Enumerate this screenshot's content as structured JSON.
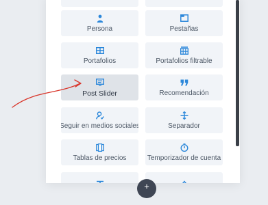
{
  "modules": [
    {
      "label": "",
      "icon": "blank-icon"
    },
    {
      "label": "",
      "icon": "blank-icon"
    },
    {
      "label": "Persona",
      "icon": "person-icon"
    },
    {
      "label": "Pestañas",
      "icon": "tabs-icon"
    },
    {
      "label": "Portafolios",
      "icon": "portfolio-grid-icon"
    },
    {
      "label": "Portafolios filtrable",
      "icon": "filterable-portfolio-icon"
    },
    {
      "label": "Post Slider",
      "icon": "post-slider-icon"
    },
    {
      "label": "Recomendación",
      "icon": "quote-icon"
    },
    {
      "label": "Seguir en medios sociales",
      "icon": "social-follow-icon"
    },
    {
      "label": "Separador",
      "icon": "divider-icon"
    },
    {
      "label": "Tablas de precios",
      "icon": "pricing-tables-icon"
    },
    {
      "label": "Temporizador de cuenta",
      "icon": "countdown-timer-icon"
    },
    {
      "label": "",
      "icon": "text-icon"
    },
    {
      "label": "",
      "icon": "toggle-icon"
    }
  ],
  "selected_module": "Post Slider",
  "colors": {
    "accent": "#2b87da",
    "tile_bg": "#f1f4f8",
    "tile_selected_bg": "#dfe3e8",
    "annotation_arrow": "#d9362b",
    "fab_bg": "#3f4654"
  },
  "fab": {
    "label": "+"
  }
}
